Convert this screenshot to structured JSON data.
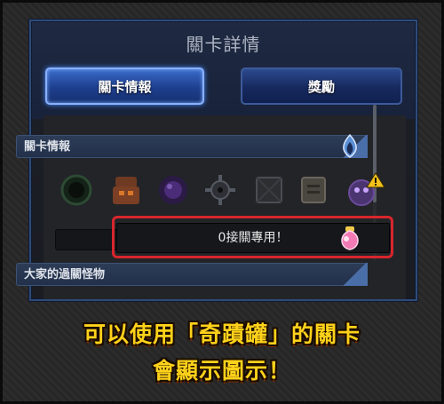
{
  "panel": {
    "title": "關卡詳情"
  },
  "tabs": [
    {
      "label": "關卡情報",
      "active": true
    },
    {
      "label": "獎勵",
      "active": false
    }
  ],
  "sections": {
    "stage_info": "關卡情報",
    "cleared_monsters": "大家的過關怪物"
  },
  "notice": {
    "text": "0接關專用！"
  },
  "caption": {
    "line1": "可以使用「奇蹟罐」的關卡",
    "line2": "會顯示圖示！"
  },
  "icons": [
    "dark-vortex-icon",
    "fire-golem-icon",
    "dark-orb-icon",
    "spiked-gear-icon",
    "block-icon",
    "stone-tablet-icon",
    "warning-boss-icon",
    "element-flame-icon",
    "miracle-jar-icon"
  ],
  "colors": {
    "accent": "#3a6bc9",
    "highlight": "#d8262c",
    "caption": "#ffd21a"
  }
}
